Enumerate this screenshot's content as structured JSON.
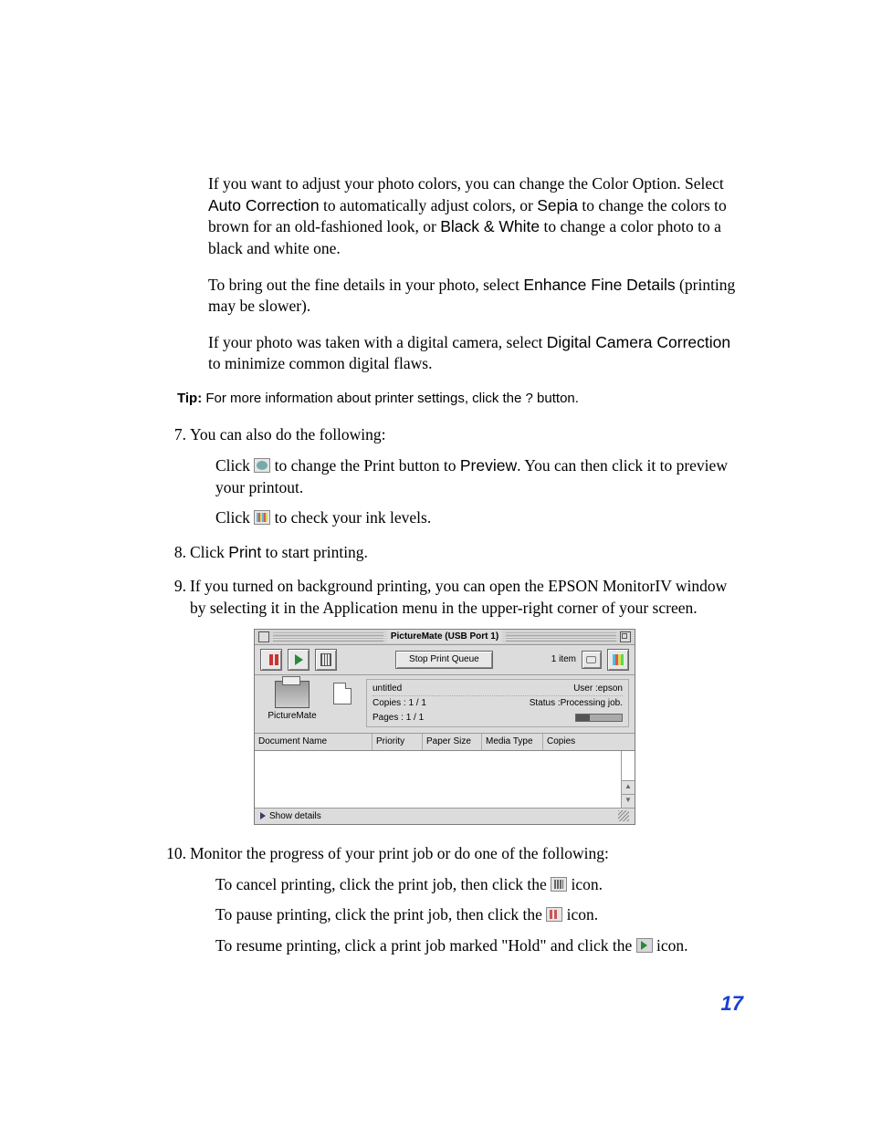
{
  "intro": {
    "p1_a": "If you want to adjust your photo colors, you can change the Color Option. Select ",
    "p1_b": "Auto Correction",
    "p1_c": " to automatically adjust colors, or ",
    "p1_d": "Sepia",
    "p1_e": " to change the colors to brown for an old-fashioned look, or ",
    "p1_f": "Black & White",
    "p1_g": " to change a color photo to a black and white one.",
    "p2_a": "To bring out the fine details in your photo, select ",
    "p2_b": "Enhance Fine Details",
    "p2_c": " (printing may be slower).",
    "p3_a": "If your photo was taken with a digital camera, select ",
    "p3_b": "Digital Camera Correction",
    "p3_c": " to minimize common digital flaws."
  },
  "tip": {
    "label": "Tip:",
    "text_a": " For more information about printer settings, click the ",
    "q": "?",
    "text_b": " button."
  },
  "steps": {
    "n7": "7.",
    "s7": "You can also do the following:",
    "s7a_a": "Click ",
    "s7a_b": " to change the Print button to ",
    "s7a_c": "Preview",
    "s7a_d": ". You can then click it to preview your printout.",
    "s7b_a": "Click ",
    "s7b_b": " to check your ink levels.",
    "n8": "8.",
    "s8_a": "Click ",
    "s8_b": "Print",
    "s8_c": " to start printing.",
    "n9": "9.",
    "s9": "If you turned on background printing, you can open the EPSON MonitorIV window by selecting it in the Application menu in the upper-right corner of your screen.",
    "n10": "10.",
    "s10": "Monitor the progress of your print job or do one of the following:",
    "s10a_a": "To cancel printing, click the print job, then click the ",
    "s10a_b": " icon.",
    "s10b_a": "To pause printing, click the print job, then click the ",
    "s10b_b": " icon.",
    "s10c_a": "To resume printing, click a print job marked \"Hold\" and click the ",
    "s10c_b": " icon."
  },
  "window": {
    "title": "PictureMate (USB Port 1)",
    "stop_queue": "Stop Print Queue",
    "item_count": "1 item",
    "printer_label": "PictureMate",
    "doc_name": "untitled",
    "user_label": "User :",
    "user_value": "epson",
    "copies": "Copies : 1 / 1",
    "status_label": "Status :",
    "status_value": "Processing job.",
    "pages": "Pages : 1 / 1",
    "col_doc": "Document Name",
    "col_pri": "Priority",
    "col_paper": "Paper Size",
    "col_media": "Media Type",
    "col_copies": "Copies",
    "show_details": "Show details"
  },
  "page_number": "17"
}
